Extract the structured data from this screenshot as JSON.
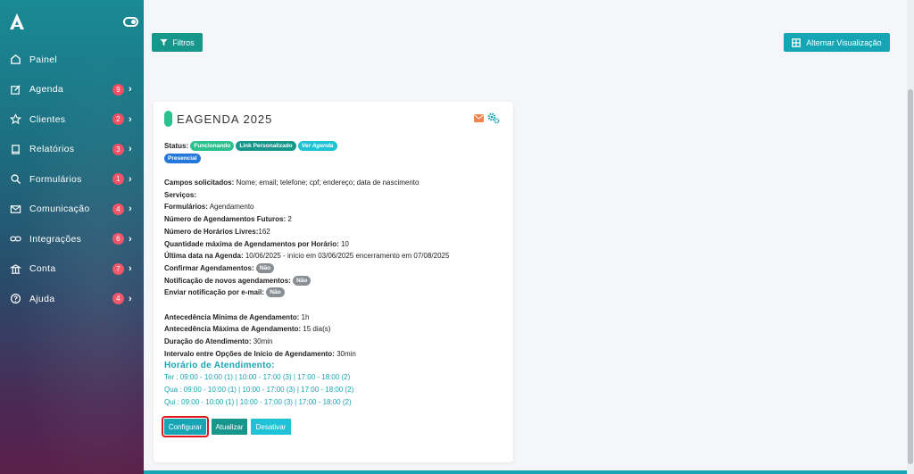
{
  "sidebar": {
    "items": [
      {
        "label": "Painel",
        "icon": "home-icon",
        "badge": ""
      },
      {
        "label": "Agenda",
        "icon": "edit-icon",
        "badge": "9"
      },
      {
        "label": "Clientes",
        "icon": "star-icon",
        "badge": "2"
      },
      {
        "label": "Relatórios",
        "icon": "book-icon",
        "badge": "3"
      },
      {
        "label": "Formulários",
        "icon": "search-icon",
        "badge": "1"
      },
      {
        "label": "Comunicação",
        "icon": "mail-icon",
        "badge": "4"
      },
      {
        "label": "Integrações",
        "icon": "link-icon",
        "badge": "6"
      },
      {
        "label": "Conta",
        "icon": "bank-icon",
        "badge": "7"
      },
      {
        "label": "Ajuda",
        "icon": "help-icon",
        "badge": "4"
      }
    ]
  },
  "toolbar": {
    "filters_label": "Filtros",
    "toggle_view_label": "Alternar Visualização"
  },
  "card": {
    "title": "EAGENDA 2025",
    "status_label": "Status:",
    "tags": {
      "funcionando": "Funcionando",
      "link": "Link Personalizado",
      "ver": "Ver Agenda",
      "presencial": "Presencial"
    },
    "fields": {
      "campos_label": "Campos solicitados:",
      "campos_value": " Nome; email; telefone; cpf; endereço; data de nascimento",
      "servicos_label": "Serviços:",
      "formularios_label": "Formulários:",
      "formularios_value": " Agendamento",
      "futuros_label": "Número de Agendamentos Futuros:",
      "futuros_value": " 2",
      "livres_label": "Número de Horários Livres:",
      "livres_value": "162",
      "max_label": "Quantidade máxima de Agendamentos por Horário:",
      "max_value": " 10",
      "ultima_label": "Última data na Agenda:",
      "ultima_value": " 10/06/2025 - início em 03/06/2025 encerramento em 07/08/2025",
      "confirmar_label": "Confirmar Agendamentos:",
      "notif_novos_label": "Notificação de novos agendamentos:",
      "notif_email_label": "Enviar notificação por e-mail:",
      "nao": "Não",
      "ant_min_label": "Antecedência Mínima de Agendamento:",
      "ant_min_value": " 1h",
      "ant_max_label": "Antecedência Máxima de Agendamento:",
      "ant_max_value": " 15 dia(s)",
      "duracao_label": "Duração do Atendimento:",
      "duracao_value": " 30min",
      "intervalo_label": "Intervalo entre Opções de Início de Agendamento:",
      "intervalo_value": " 30min"
    },
    "schedule_heading": "Horário de Atendimento:",
    "schedule": [
      "Ter : 09:00 - 10:00 (1) | 10:00 - 17:00 (3) | 17:00 - 18:00 (2)",
      "Qua : 09:00 - 10:00 (1) | 10:00 - 17:00 (3) | 17:00 - 18:00 (2)",
      "Qui : 09:00 - 10:00 (1) | 10:00 - 17:00 (3) | 17:00 - 18:00 (2)"
    ],
    "actions": {
      "configurar": "Configurar",
      "atualizar": "Atualizar",
      "desativar": "Desativar"
    }
  },
  "colors": {
    "accent": "#15a5b5",
    "teal": "#17968c",
    "green": "#2ac38f",
    "badge": "#ef4d61",
    "highlight": "#e0161b"
  }
}
